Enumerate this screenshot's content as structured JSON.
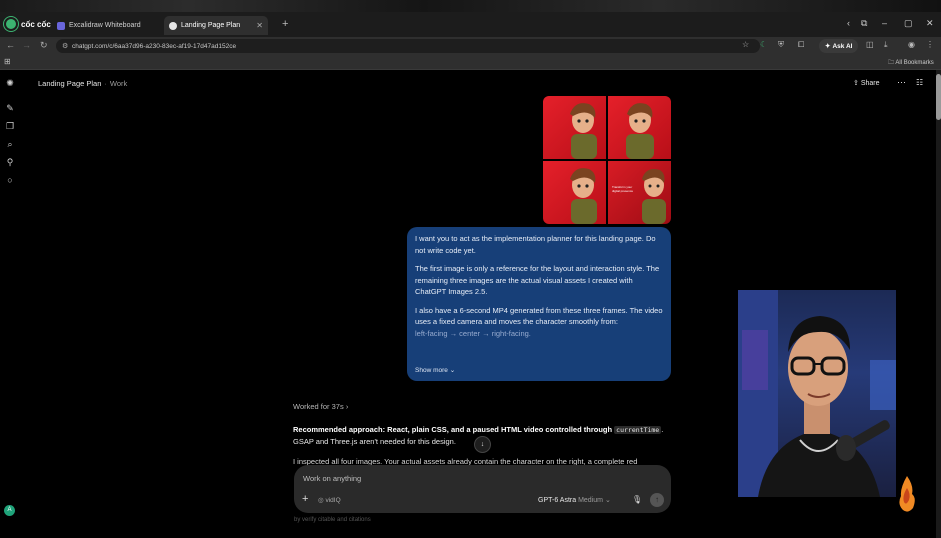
{
  "browser": {
    "brand": "cốc cốc",
    "tabs": [
      {
        "label": "Excalidraw Whiteboard",
        "active": false
      },
      {
        "label": "Landing Page Plan",
        "active": true
      }
    ],
    "url": "chatgpt.com/c/6aa37d96-a230-83ec-af19-17d47ad152ce",
    "ask_ai": "Ask AI",
    "all_bookmarks": "All Bookmarks"
  },
  "header": {
    "title": "Landing Page Plan",
    "project": "Work",
    "share": "Share"
  },
  "images": {
    "tile_caption": "Transform your digital presence"
  },
  "message": {
    "paragraphs": [
      "I want you to act as the implementation planner for this landing page. Do not write code yet.",
      "The first image is only a reference for the layout and interaction style. The remaining three images are the actual visual assets I created with ChatGPT Images 2.5.",
      "I also have a 6-second MP4 generated from these three frames. The video uses a fixed camera and moves the character smoothly from:"
    ],
    "faded": "left-facing → center → right-facing.",
    "show_more": "Show more"
  },
  "response": {
    "worked": "Worked for 37s",
    "bold": "Recommended approach: React, plain CSS, and a paused HTML video controlled through",
    "code": "currentTime",
    "rest": "GSAP and Three.js aren't needed for this design.",
    "line2": "I inspected all four images. Your actual assets already contain the character on the right, a complete red"
  },
  "composer": {
    "placeholder": "Work on anything",
    "vidiq": "vidIQ",
    "model": "GPT-6 Astra",
    "effort": "Medium"
  },
  "footer_hint": "by verify citable and citations",
  "colors": {
    "bubble": "#173f78",
    "tile_red": "#e5202a",
    "accent_green": "#1fa37a"
  }
}
